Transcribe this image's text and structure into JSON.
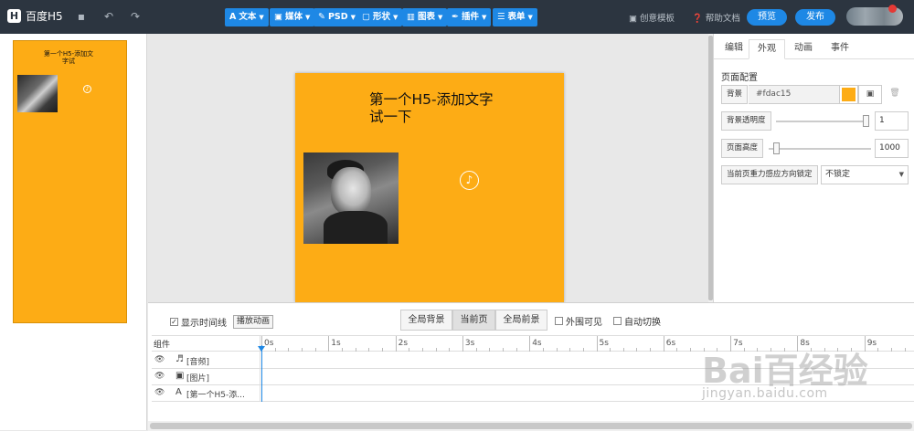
{
  "topbar": {
    "logo_text": "百度H5",
    "toolbar": [
      {
        "label": "文本",
        "icon": "A"
      },
      {
        "label": "媒体",
        "icon": "▣"
      },
      {
        "label": "PSD",
        "icon": "✎"
      },
      {
        "label": "形状",
        "icon": "▢"
      },
      {
        "label": "图表",
        "icon": "▥"
      },
      {
        "label": "插件",
        "icon": "✒"
      },
      {
        "label": "表单",
        "icon": "☰"
      }
    ],
    "creative_template": "创意模板",
    "help_doc": "帮助文档",
    "preview": "预览",
    "publish": "发布"
  },
  "thumbnail": {
    "title": "第一个H5-添加文字试"
  },
  "page": {
    "title": "第一个H5-添加文字试一下",
    "background": "#fdac15"
  },
  "right_panel": {
    "tabs": [
      "编辑",
      "外观",
      "动画",
      "事件"
    ],
    "section_title": "页面配置",
    "bg_label": "背景",
    "bg_value": "#fdac15",
    "opacity_label": "背景透明度",
    "opacity_value": "1",
    "opacity_level": 1.0,
    "height_label": "页面高度",
    "height_value": "1000",
    "height_level": 0.05,
    "gravity_label": "当前页重力感应方向锁定",
    "gravity_value": "不锁定"
  },
  "bottom": {
    "show_timeline": "显示时间线",
    "play_animation": "播放动画",
    "segments": [
      "全局背景",
      "当前页",
      "全局前景"
    ],
    "outer_visible": "外围可见",
    "auto_switch": "自动切换",
    "timeline": {
      "column_header": "组件",
      "ticks": [
        "0s",
        "1s",
        "2s",
        "3s",
        "4s",
        "5s",
        "6s",
        "7s",
        "8s",
        "9s"
      ],
      "rows": [
        {
          "icon": "♬",
          "name": "[音频]"
        },
        {
          "icon": "▣",
          "name": "[图片]"
        },
        {
          "icon": "A",
          "name": "[第一个H5-添..."
        }
      ]
    }
  },
  "watermark": {
    "main": "Bai百经验",
    "sub": "jingyan.baidu.com"
  },
  "colors": {
    "topbar": "#2c3540",
    "accent": "#1e88e5",
    "page_bg": "#fdac15"
  }
}
